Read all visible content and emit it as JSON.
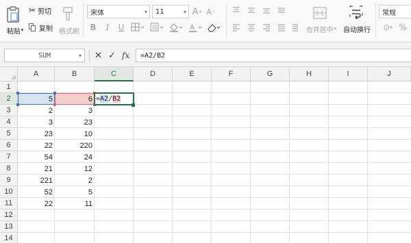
{
  "ribbon": {
    "paste_label": "粘贴",
    "cut_label": "剪切",
    "copy_label": "复制",
    "format_painter_label": "格式刷",
    "font_name": "宋体",
    "font_size": "11",
    "bold": "B",
    "italic": "I",
    "underline": "U",
    "merge_center_label": "合并居中",
    "wrap_text_label": "自动换行",
    "number_format": "常规"
  },
  "formula_bar": {
    "name_box": "SUM",
    "cancel_icon": "✕",
    "enter_icon": "✓",
    "fx_label": "fx",
    "formula": "=A2/B2"
  },
  "columns": [
    "A",
    "B",
    "C",
    "D",
    "E",
    "F",
    "G",
    "H",
    "I",
    "J"
  ],
  "selected_column": "C",
  "rows": [
    "1",
    "2",
    "3",
    "4",
    "5",
    "6",
    "7",
    "8",
    "9",
    "10",
    "11",
    "12",
    "13",
    "14"
  ],
  "selected_row": "2",
  "cells": {
    "A": [
      "",
      "5",
      "2",
      "3",
      "23",
      "22",
      "54",
      "21",
      "221",
      "52",
      "22",
      "",
      "",
      ""
    ],
    "B": [
      "",
      "6",
      "3",
      "23",
      "10",
      "220",
      "24",
      "12",
      "2",
      "5",
      "11",
      "",
      "",
      ""
    ]
  },
  "edit_cell": {
    "prefix": "=",
    "ref1": "A2",
    "op": "/",
    "ref2": "B2"
  },
  "colors": {
    "accent": "#217346",
    "ref1_color": "#4472c4",
    "ref2_color": "#d46a6a"
  }
}
